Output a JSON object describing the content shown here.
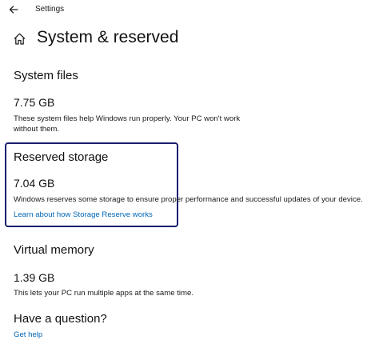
{
  "header": {
    "app_title": "Settings",
    "back_icon": "back-arrow-icon"
  },
  "page": {
    "title": "System & reserved",
    "icon": "home-icon"
  },
  "system_files": {
    "title": "System files",
    "size": "7.75 GB",
    "description_line1": "These system files help Windows run properly. Your PC won't work",
    "description_line2": "without them."
  },
  "reserved_storage": {
    "title": "Reserved storage",
    "size": "7.04 GB",
    "description": "Windows reserves some storage to ensure proper performance and successful updates of your device.",
    "link": "Learn about how Storage Reserve works",
    "highlight_color": "#1b1f6e"
  },
  "virtual_memory": {
    "title": "Virtual memory",
    "size": "1.39 GB",
    "description": "This lets your PC run multiple apps at the same time."
  },
  "help": {
    "title": "Have a question?",
    "link": "Get help"
  },
  "colors": {
    "link": "#0067b8",
    "text": "#111111",
    "background": "#ffffff"
  }
}
